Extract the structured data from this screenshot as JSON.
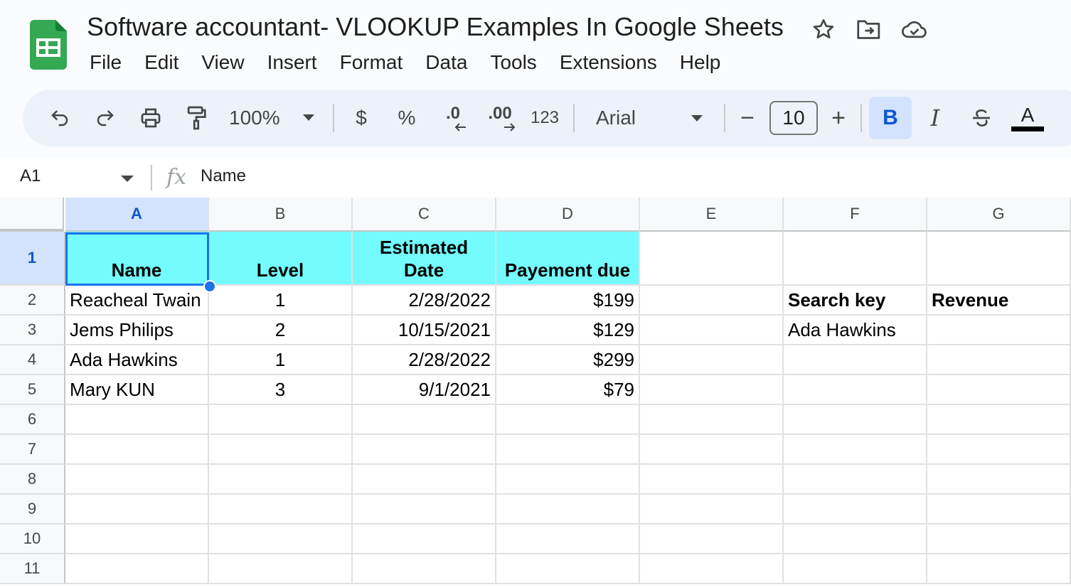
{
  "header": {
    "title": "Software accountant- VLOOKUP Examples In Google Sheets",
    "menu": [
      "File",
      "Edit",
      "View",
      "Insert",
      "Format",
      "Data",
      "Tools",
      "Extensions",
      "Help"
    ],
    "icons": [
      "star-icon",
      "move-folder-icon",
      "cloud-saved-icon"
    ]
  },
  "toolbar": {
    "zoom": "100%",
    "currency_label": "$",
    "percent_label": "%",
    "decrease_decimal_label": ".0",
    "increase_decimal_label": ".00",
    "more_formats_label": "123",
    "font": "Arial",
    "minus_label": "−",
    "font_size": "10",
    "plus_label": "+",
    "bold_label": "B",
    "italic_label": "I",
    "text_color_label": "A"
  },
  "formula_bar": {
    "name_box": "A1",
    "fx_label": "fx",
    "value": "Name"
  },
  "grid": {
    "columns": [
      "A",
      "B",
      "C",
      "D",
      "E",
      "F",
      "G"
    ],
    "rows": [
      "1",
      "2",
      "3",
      "4",
      "5",
      "6",
      "7",
      "8",
      "9",
      "10",
      "11"
    ],
    "headers": {
      "a": "Name",
      "b": "Level",
      "c_line1": "Estimated",
      "c_line2": "Date",
      "d": "Payement due"
    },
    "data": [
      {
        "name": "Reacheal Twain",
        "level": "1",
        "date": "2/28/2022",
        "due": "$199"
      },
      {
        "name": "Jems Philips",
        "level": "2",
        "date": "10/15/2021",
        "due": "$129"
      },
      {
        "name": "Ada Hawkins",
        "level": "1",
        "date": "2/28/2022",
        "due": "$299"
      },
      {
        "name": "Mary KUN",
        "level": "3",
        "date": "9/1/2021",
        "due": "$79"
      }
    ],
    "side": {
      "search_key_label": "Search key",
      "revenue_label": "Revenue",
      "search_key_value": "Ada Hawkins"
    },
    "header_fill_color": "#73fbfd",
    "selection_color": "#1a73e8"
  }
}
